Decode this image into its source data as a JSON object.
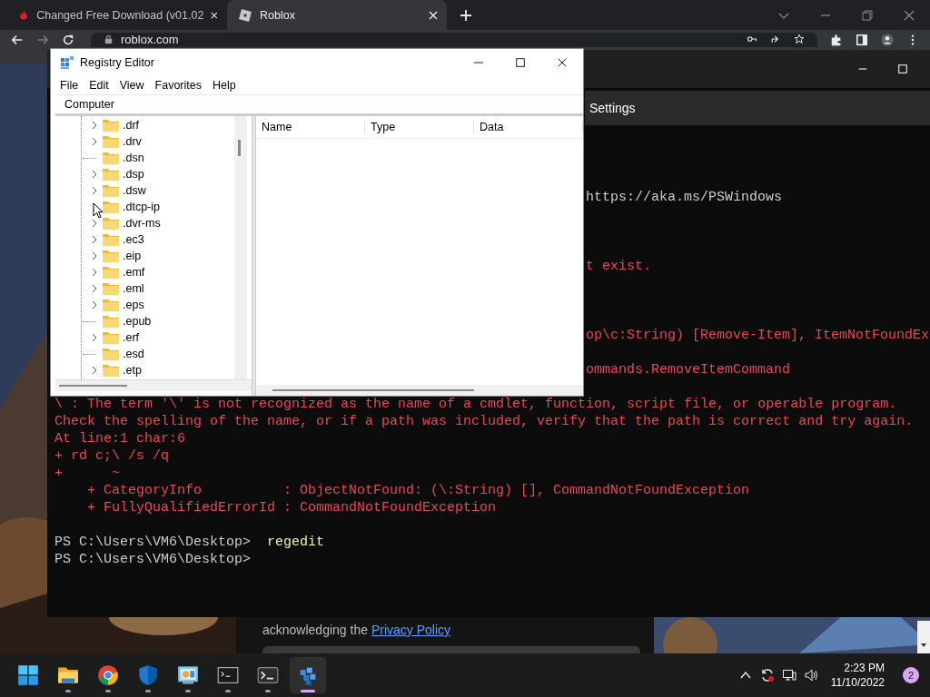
{
  "browser": {
    "tabs": [
      {
        "title": "Changed Free Download (v01.02",
        "kind": "game",
        "selected": false
      },
      {
        "title": "Roblox",
        "kind": "site",
        "selected": true
      }
    ],
    "address": "roblox.com",
    "page": {
      "notice": "acknowledging the",
      "notice_link": "Privacy Policy"
    }
  },
  "terminal": {
    "menu_item": "Settings",
    "lines": [
      {
        "kind": "output",
        "cut": true,
        "text": "https://aka.ms/PSWindows"
      },
      {
        "kind": "blank"
      },
      {
        "kind": "blank"
      },
      {
        "kind": "blank"
      },
      {
        "kind": "error",
        "cut": true,
        "text": "t exist."
      },
      {
        "kind": "blank"
      },
      {
        "kind": "blank"
      },
      {
        "kind": "blank"
      },
      {
        "kind": "error",
        "cut": true,
        "text": "op\\c:String) [Remove-Item], ItemNotFoundEx"
      },
      {
        "kind": "blank"
      },
      {
        "kind": "error",
        "cut": true,
        "text": "ommands.RemoveItemCommand"
      },
      {
        "kind": "blank"
      },
      {
        "kind": "error",
        "cut": false,
        "text": "\\ : The term '\\' is not recognized as the name of a cmdlet, function, script file, or operable program."
      },
      {
        "kind": "error",
        "cut": false,
        "text": "Check the spelling of the name, or if a path was included, verify that the path is correct and try again."
      },
      {
        "kind": "error",
        "cut": false,
        "text": "At line:1 char:6"
      },
      {
        "kind": "error",
        "cut": false,
        "text": "+ rd c;\\ /s /q"
      },
      {
        "kind": "error",
        "cut": false,
        "text": "+      ~"
      },
      {
        "kind": "error",
        "cut": false,
        "text": "    + CategoryInfo          : ObjectNotFound: (\\:String) [], CommandNotFoundException"
      },
      {
        "kind": "error",
        "cut": false,
        "text": "    + FullyQualifiedErrorId : CommandNotFoundException"
      },
      {
        "kind": "blank"
      },
      {
        "kind": "prompt",
        "cut": false,
        "text": "PS C:\\Users\\VM6\\Desktop>",
        "command": "regedit"
      },
      {
        "kind": "prompt",
        "cut": false,
        "text": "PS C:\\Users\\VM6\\Desktop>"
      }
    ]
  },
  "registry_editor": {
    "title": "Registry Editor",
    "menu": [
      "File",
      "Edit",
      "View",
      "Favorites",
      "Help"
    ],
    "address": "Computer",
    "tree": [
      {
        "label": ".drf",
        "expandable": true
      },
      {
        "label": ".drv",
        "expandable": true
      },
      {
        "label": ".dsn",
        "expandable": false
      },
      {
        "label": ".dsp",
        "expandable": true
      },
      {
        "label": ".dsw",
        "expandable": true
      },
      {
        "label": ".dtcp-ip",
        "expandable": true
      },
      {
        "label": ".dvr-ms",
        "expandable": true
      },
      {
        "label": ".ec3",
        "expandable": true
      },
      {
        "label": ".eip",
        "expandable": true
      },
      {
        "label": ".emf",
        "expandable": true
      },
      {
        "label": ".eml",
        "expandable": true
      },
      {
        "label": ".eps",
        "expandable": true
      },
      {
        "label": ".epub",
        "expandable": false
      },
      {
        "label": ".erf",
        "expandable": true
      },
      {
        "label": ".esd",
        "expandable": false
      },
      {
        "label": ".etp",
        "expandable": true
      }
    ],
    "columns": [
      "Name",
      "Type",
      "Data"
    ]
  },
  "taskbar": {
    "apps": [
      {
        "kind": "start",
        "selected": false
      },
      {
        "kind": "files",
        "selected": false
      },
      {
        "kind": "chrome",
        "selected": false
      },
      {
        "kind": "shield",
        "selected": false
      },
      {
        "kind": "control-panel",
        "selected": false
      },
      {
        "kind": "cmd",
        "selected": false
      },
      {
        "kind": "terminal",
        "selected": false
      },
      {
        "kind": "registry",
        "selected": true
      }
    ],
    "time": "2:23 PM",
    "date": "11/10/2022",
    "notifications": "2"
  }
}
